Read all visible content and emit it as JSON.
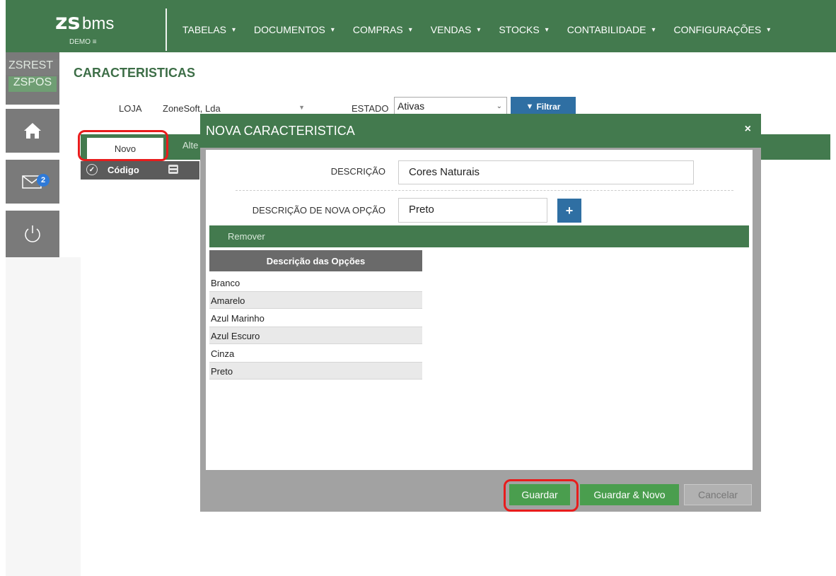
{
  "app": {
    "logo_brand": "zs",
    "logo_text": "bms",
    "logo_demo": "DEMO ≡"
  },
  "nav": {
    "items": [
      {
        "label": "TABELAS"
      },
      {
        "label": "DOCUMENTOS"
      },
      {
        "label": "COMPRAS"
      },
      {
        "label": "VENDAS"
      },
      {
        "label": "STOCKS"
      },
      {
        "label": "CONTABILIDADE"
      },
      {
        "label": "CONFIGURAÇÕES"
      }
    ],
    "caret": "▾"
  },
  "sidebar": {
    "zsrest": "ZSREST",
    "zspos": "ZSPOS",
    "home_icon": "home-icon",
    "mail_icon": "mail-icon",
    "mail_badge": "2",
    "power_icon": "power-icon"
  },
  "page": {
    "title": "CARACTERISTICAS",
    "loja_label": "LOJA",
    "loja_value": "ZoneSoft, Lda",
    "estado_label": "ESTADO",
    "estado_value": "Ativas",
    "filtrar_label": "Filtrar",
    "tab_novo": "Novo",
    "tab_alterar": "Alte",
    "grid_col_codigo": "Código"
  },
  "modal": {
    "title": "NOVA CARACTERISTICA",
    "close": "×",
    "descricao_label": "DESCRIÇÃO",
    "descricao_value": "Cores Naturais",
    "nova_opcao_label": "DESCRIÇÃO DE NOVA OPÇÃO",
    "nova_opcao_value": "Preto",
    "add_label": "+",
    "remover_label": "Remover",
    "options_header": "Descrição das Opções",
    "options": [
      "Branco",
      "Amarelo",
      "Azul Marinho",
      "Azul Escuro",
      "Cinza",
      "Preto"
    ],
    "guardar": "Guardar",
    "guardar_novo": "Guardar & Novo",
    "cancelar": "Cancelar"
  },
  "colors": {
    "brand_green": "#437a4e",
    "button_blue": "#2f6fa3",
    "save_green": "#4a9e4e",
    "highlight_red": "#e81c1c"
  }
}
